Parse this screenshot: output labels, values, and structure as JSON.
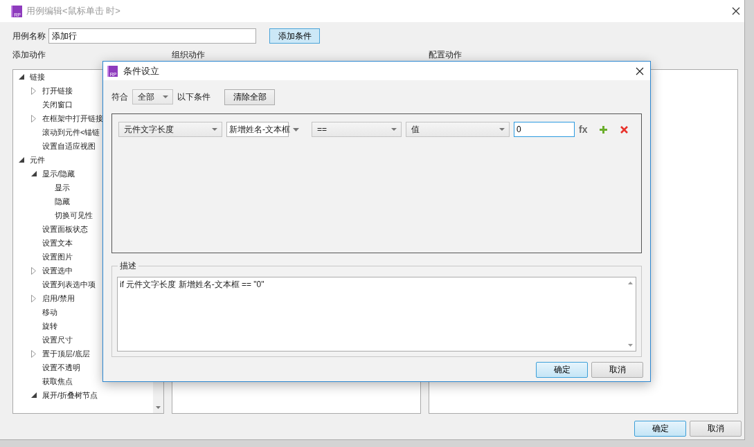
{
  "window": {
    "logo_text": "RP",
    "title": "用例编辑<鼠标单击 时>"
  },
  "case_name": {
    "label": "用例名称",
    "value": "添加行"
  },
  "add_condition_button": "添加条件",
  "columns": [
    {
      "label": "添加动作"
    },
    {
      "label": "组织动作"
    },
    {
      "label": "配置动作"
    }
  ],
  "action_tree": [
    {
      "label": "链接",
      "kind": "branch",
      "expanded": true,
      "children": [
        {
          "label": "打开链接",
          "kind": "branch",
          "expanded": false
        },
        {
          "label": "关闭窗口",
          "kind": "leaf"
        },
        {
          "label": "在框架中打开链接",
          "kind": "branch",
          "expanded": false
        },
        {
          "label": "滚动到元件<锚链",
          "kind": "leaf"
        },
        {
          "label": "设置自适应视图",
          "kind": "leaf"
        }
      ]
    },
    {
      "label": "元件",
      "kind": "branch",
      "expanded": true,
      "children": [
        {
          "label": "显示/隐藏",
          "kind": "branch",
          "expanded": true,
          "children": [
            {
              "label": "显示",
              "kind": "leaf"
            },
            {
              "label": "隐藏",
              "kind": "leaf"
            },
            {
              "label": "切换可见性",
              "kind": "leaf"
            }
          ]
        },
        {
          "label": "设置面板状态",
          "kind": "leaf"
        },
        {
          "label": "设置文本",
          "kind": "leaf"
        },
        {
          "label": "设置图片",
          "kind": "leaf"
        },
        {
          "label": "设置选中",
          "kind": "branch",
          "expanded": false
        },
        {
          "label": "设置列表选中项",
          "kind": "leaf"
        },
        {
          "label": "启用/禁用",
          "kind": "branch",
          "expanded": false
        },
        {
          "label": "移动",
          "kind": "leaf"
        },
        {
          "label": "旋转",
          "kind": "leaf"
        },
        {
          "label": "设置尺寸",
          "kind": "leaf"
        },
        {
          "label": "置于顶层/底层",
          "kind": "branch",
          "expanded": false
        },
        {
          "label": "设置不透明",
          "kind": "leaf"
        },
        {
          "label": "获取焦点",
          "kind": "leaf"
        },
        {
          "label": "展开/折叠树节点",
          "kind": "branch",
          "expanded": true
        }
      ]
    }
  ],
  "buttons": [
    {
      "label": "确定",
      "default": true
    },
    {
      "label": "取消",
      "default": false
    }
  ],
  "dialog": {
    "logo_text": "RP",
    "title": "条件设立",
    "match_label": "符合",
    "match_value": "全部",
    "match_suffix": "以下条件",
    "clear_button": "清除全部",
    "conditions": [
      {
        "selects": [
          "元件文字长度",
          "新增姓名-文本框",
          "==",
          "值"
        ],
        "value": "0",
        "fx": "fx"
      }
    ],
    "description_label": "描述",
    "description": "if 元件文字长度 新增姓名-文本框 == \"0\"",
    "buttons": [
      {
        "label": "确定",
        "default": true
      },
      {
        "label": "取消",
        "default": false
      }
    ]
  }
}
